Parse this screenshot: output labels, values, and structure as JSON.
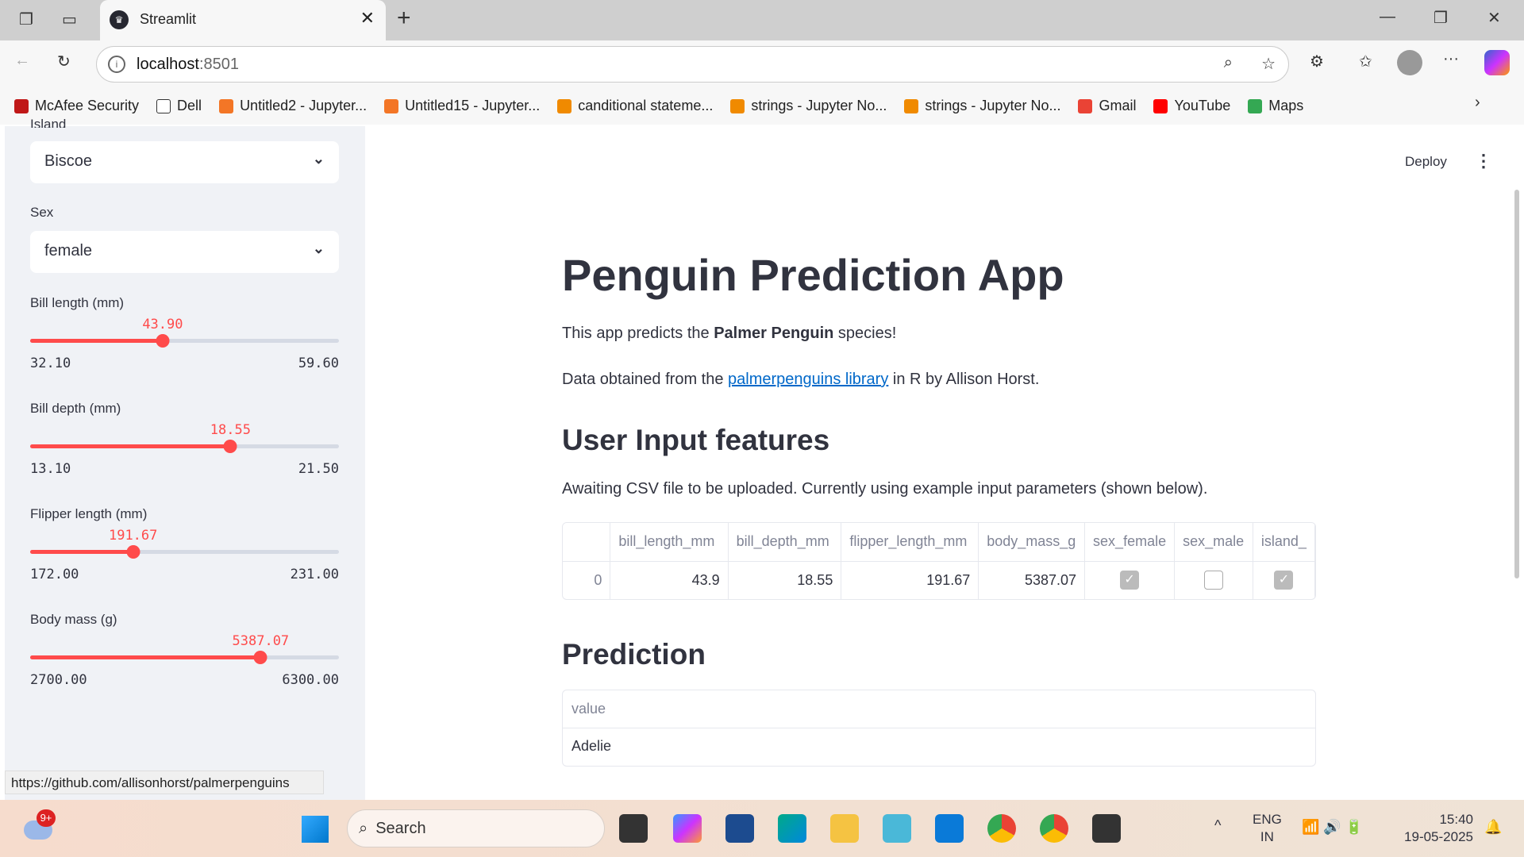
{
  "browser": {
    "tab_title": "Streamlit",
    "url_host": "localhost",
    "url_port": ":8501",
    "bookmarks": [
      {
        "label": "McAfee Security",
        "icon": "mcafee-icon",
        "color": "#c01818"
      },
      {
        "label": "Dell",
        "icon": "folder-icon",
        "color": "#ffffff"
      },
      {
        "label": "Untitled2 - Jupyter...",
        "icon": "jupyter-icon",
        "color": "#f37626"
      },
      {
        "label": "Untitled15 - Jupyter...",
        "icon": "jupyter-icon",
        "color": "#f37626"
      },
      {
        "label": "canditional stateme...",
        "icon": "notebook-icon",
        "color": "#f08a00"
      },
      {
        "label": "strings - Jupyter No...",
        "icon": "notebook-icon",
        "color": "#f08a00"
      },
      {
        "label": "strings - Jupyter No...",
        "icon": "notebook-icon",
        "color": "#f08a00"
      },
      {
        "label": "Gmail",
        "icon": "gmail-icon",
        "color": "#ea4335"
      },
      {
        "label": "YouTube",
        "icon": "youtube-icon",
        "color": "#ff0000"
      },
      {
        "label": "Maps",
        "icon": "maps-icon",
        "color": "#34a853"
      }
    ],
    "status_url": "https://github.com/allisonhorst/palmerpenguins"
  },
  "sidebar": {
    "island": {
      "label": "Island",
      "value": "Biscoe"
    },
    "sex": {
      "label": "Sex",
      "value": "female"
    },
    "sliders": [
      {
        "label": "Bill length (mm)",
        "value": "43.90",
        "min": "32.10",
        "max": "59.60",
        "v": 43.9,
        "lo": 32.1,
        "hi": 59.6
      },
      {
        "label": "Bill depth (mm)",
        "value": "18.55",
        "min": "13.10",
        "max": "21.50",
        "v": 18.55,
        "lo": 13.1,
        "hi": 21.5
      },
      {
        "label": "Flipper length (mm)",
        "value": "191.67",
        "min": "172.00",
        "max": "231.00",
        "v": 191.67,
        "lo": 172,
        "hi": 231
      },
      {
        "label": "Body mass (g)",
        "value": "5387.07",
        "min": "2700.00",
        "max": "6300.00",
        "v": 5387.07,
        "lo": 2700,
        "hi": 6300
      }
    ]
  },
  "header": {
    "deploy": "Deploy"
  },
  "main": {
    "title": "Penguin Prediction App",
    "intro_pre": "This app predicts the ",
    "intro_bold": "Palmer Penguin",
    "intro_post": " species!",
    "data_pre": "Data obtained from the ",
    "data_link": "palmerpenguins library",
    "data_post": " in R by Allison Horst.",
    "features_heading": "User Input features",
    "awaiting": "Awaiting CSV file to be uploaded. Currently using example input parameters (shown below).",
    "table": {
      "columns": [
        "",
        "bill_length_mm",
        "bill_depth_mm",
        "flipper_length_mm",
        "body_mass_g",
        "sex_female",
        "sex_male",
        "island_"
      ],
      "row": {
        "index": "0",
        "bill_length_mm": "43.9",
        "bill_depth_mm": "18.55",
        "flipper_length_mm": "191.67",
        "body_mass_g": "5387.07",
        "sex_female": true,
        "sex_male": false,
        "island_": true
      }
    },
    "prediction_heading": "Prediction",
    "prediction": {
      "column": "value",
      "value": "Adelie"
    }
  },
  "taskbar": {
    "search": "Search",
    "notif_badge": "9+",
    "lang1": "ENG",
    "lang2": "IN",
    "time": "15:40",
    "date": "19-05-2025"
  },
  "accent_color": "#ff4b4b"
}
